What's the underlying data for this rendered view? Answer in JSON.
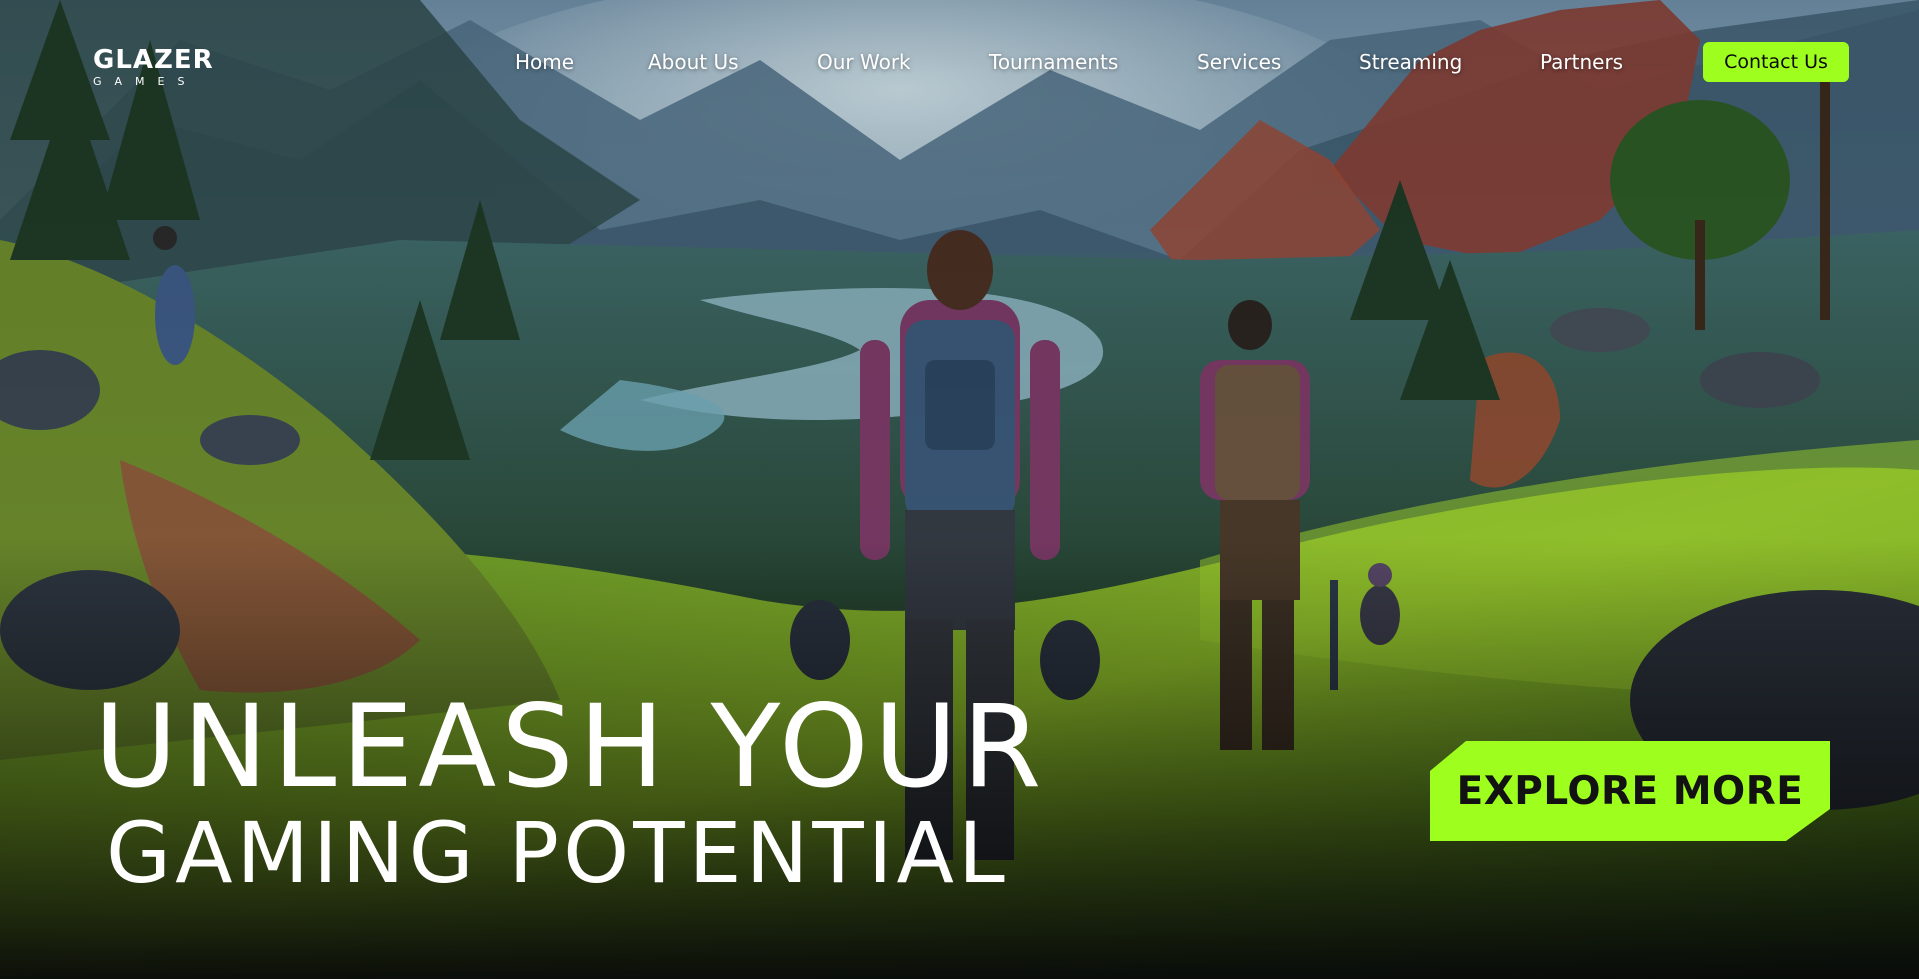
{
  "brand": {
    "name": "GLAZER",
    "tagline": "GAMES"
  },
  "nav": {
    "items": [
      {
        "label": "Home"
      },
      {
        "label": "About Us"
      },
      {
        "label": "Our Work"
      },
      {
        "label": "Tournaments"
      },
      {
        "label": "Services"
      },
      {
        "label": "Streaming"
      },
      {
        "label": "Partners"
      }
    ],
    "contact_label": "Contact Us"
  },
  "hero": {
    "line1": "UNLEASH YOUR",
    "line2": "GAMING POTENTIAL",
    "cta_label": "EXPLORE MORE"
  },
  "theme": {
    "accent": "#9eff1f",
    "text": "#ffffff"
  }
}
